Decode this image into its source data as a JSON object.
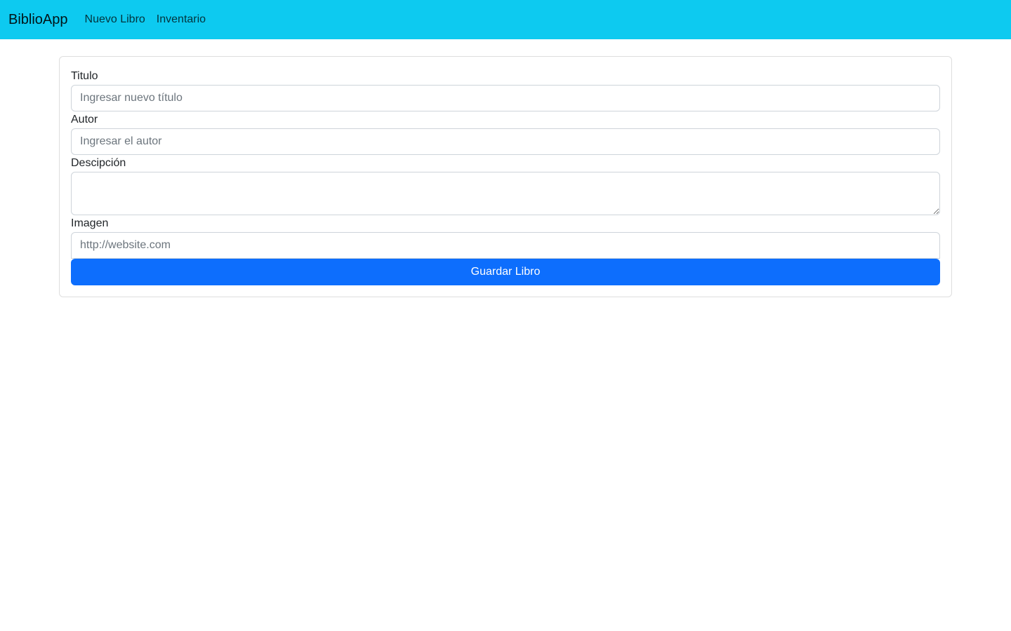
{
  "navbar": {
    "brand": "BiblioApp",
    "links": [
      {
        "label": "Nuevo Libro"
      },
      {
        "label": "Inventario"
      }
    ],
    "background_color": "#0dcaf0"
  },
  "form": {
    "titulo": {
      "label": "Titulo",
      "placeholder": "Ingresar nuevo título",
      "value": ""
    },
    "autor": {
      "label": "Autor",
      "placeholder": "Ingresar el autor",
      "value": ""
    },
    "descripcion": {
      "label": "Descipción",
      "value": ""
    },
    "imagen": {
      "label": "Imagen",
      "placeholder": "http://website.com",
      "value": ""
    },
    "submit_label": "Guardar Libro",
    "submit_color": "#0d6efd"
  }
}
